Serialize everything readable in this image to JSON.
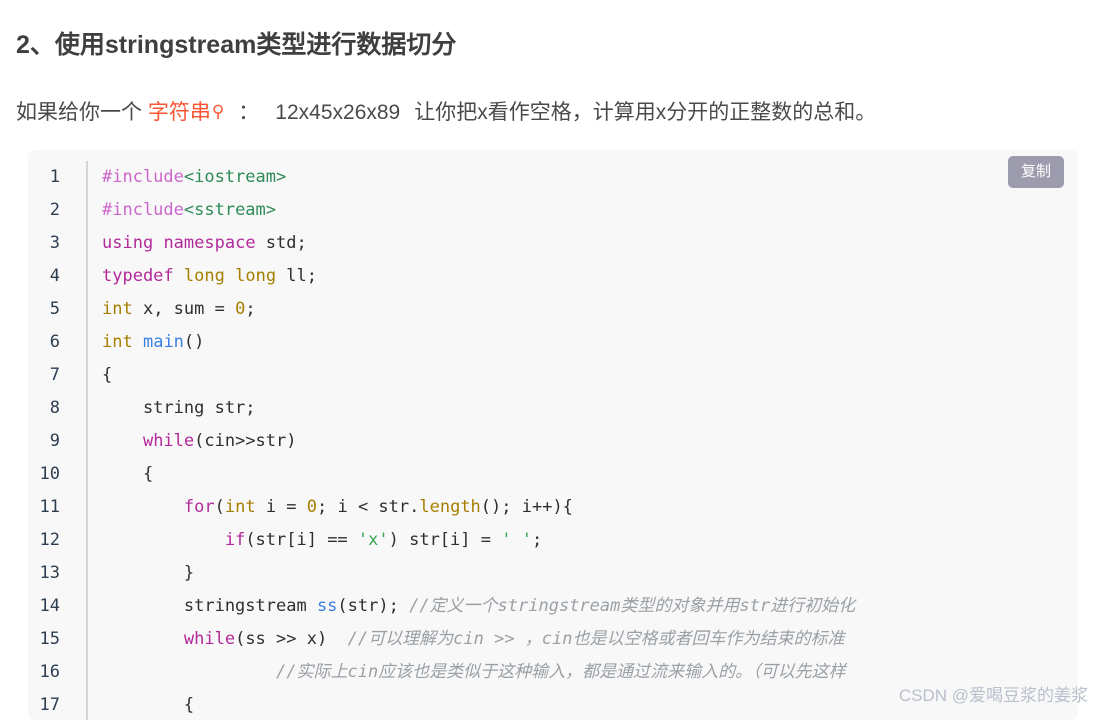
{
  "heading": "2、使用stringstream类型进行数据切分",
  "intro": {
    "prefix": "如果给你一个 ",
    "keyword_link": "字符串",
    "search_icon": "search-icon",
    "colon": "：",
    "sample": "12x45x26x89",
    "suffix": "让你把x看作空格，计算用x分开的正整数的总和。"
  },
  "code_block": {
    "copy_label": "复制",
    "language": "cpp",
    "background": "#f8f8f8",
    "lines": [
      {
        "n": "1",
        "tokens": [
          {
            "t": "#include",
            "c": "t-pre"
          },
          {
            "t": "<iostream>",
            "c": "t-inc"
          }
        ]
      },
      {
        "n": "2",
        "tokens": [
          {
            "t": "#include",
            "c": "t-pre"
          },
          {
            "t": "<sstream>",
            "c": "t-inc"
          }
        ]
      },
      {
        "n": "3",
        "tokens": [
          {
            "t": "using",
            "c": "t-kw"
          },
          {
            "t": " ",
            "c": "t-plain"
          },
          {
            "t": "namespace",
            "c": "t-kw"
          },
          {
            "t": " std;",
            "c": "t-plain"
          }
        ]
      },
      {
        "n": "4",
        "tokens": [
          {
            "t": "typedef",
            "c": "t-kw"
          },
          {
            "t": " ",
            "c": "t-plain"
          },
          {
            "t": "long",
            "c": "t-type"
          },
          {
            "t": " ",
            "c": "t-plain"
          },
          {
            "t": "long",
            "c": "t-type"
          },
          {
            "t": " ll;",
            "c": "t-plain"
          }
        ]
      },
      {
        "n": "5",
        "tokens": [
          {
            "t": "int",
            "c": "t-type"
          },
          {
            "t": " x, sum = ",
            "c": "t-plain"
          },
          {
            "t": "0",
            "c": "t-type"
          },
          {
            "t": ";",
            "c": "t-plain"
          }
        ]
      },
      {
        "n": "6",
        "tokens": [
          {
            "t": "int",
            "c": "t-type"
          },
          {
            "t": " ",
            "c": "t-plain"
          },
          {
            "t": "main",
            "c": "t-fn"
          },
          {
            "t": "()",
            "c": "t-plain"
          }
        ]
      },
      {
        "n": "7",
        "tokens": [
          {
            "t": "{",
            "c": "t-plain"
          }
        ]
      },
      {
        "n": "8",
        "tokens": [
          {
            "t": "    string str;",
            "c": "t-plain"
          }
        ]
      },
      {
        "n": "9",
        "tokens": [
          {
            "t": "    ",
            "c": "t-plain"
          },
          {
            "t": "while",
            "c": "t-kw"
          },
          {
            "t": "(cin>>str)",
            "c": "t-plain"
          }
        ]
      },
      {
        "n": "10",
        "tokens": [
          {
            "t": "    {",
            "c": "t-plain"
          }
        ]
      },
      {
        "n": "11",
        "tokens": [
          {
            "t": "        ",
            "c": "t-plain"
          },
          {
            "t": "for",
            "c": "t-kw"
          },
          {
            "t": "(",
            "c": "t-plain"
          },
          {
            "t": "int",
            "c": "t-type"
          },
          {
            "t": " i = ",
            "c": "t-plain"
          },
          {
            "t": "0",
            "c": "t-type"
          },
          {
            "t": "; i < str.",
            "c": "t-plain"
          },
          {
            "t": "length",
            "c": "t-type"
          },
          {
            "t": "(); i++){",
            "c": "t-plain"
          }
        ]
      },
      {
        "n": "12",
        "tokens": [
          {
            "t": "            ",
            "c": "t-plain"
          },
          {
            "t": "if",
            "c": "t-kw"
          },
          {
            "t": "(str[i] == ",
            "c": "t-plain"
          },
          {
            "t": "'x'",
            "c": "t-str"
          },
          {
            "t": ") str[i] = ",
            "c": "t-plain"
          },
          {
            "t": "' '",
            "c": "t-str"
          },
          {
            "t": ";",
            "c": "t-plain"
          }
        ]
      },
      {
        "n": "13",
        "tokens": [
          {
            "t": "        }",
            "c": "t-plain"
          }
        ]
      },
      {
        "n": "14",
        "tokens": [
          {
            "t": "        stringstream ",
            "c": "t-plain"
          },
          {
            "t": "ss",
            "c": "t-fn"
          },
          {
            "t": "(str); ",
            "c": "t-plain"
          },
          {
            "t": "//定义一个stringstream类型的对象并用str进行初始化",
            "c": "t-cmt"
          }
        ]
      },
      {
        "n": "15",
        "tokens": [
          {
            "t": "        ",
            "c": "t-plain"
          },
          {
            "t": "while",
            "c": "t-kw"
          },
          {
            "t": "(ss >> x)  ",
            "c": "t-plain"
          },
          {
            "t": "//可以理解为cin >> ，cin也是以空格或者回车作为结束的标准",
            "c": "t-cmt"
          }
        ]
      },
      {
        "n": "16",
        "tokens": [
          {
            "t": "                 ",
            "c": "t-plain"
          },
          {
            "t": "//实际上cin应该也是类似于这种输入，都是通过流来输入的。（可以先这样",
            "c": "t-cmt"
          }
        ]
      },
      {
        "n": "17",
        "tokens": [
          {
            "t": "        {",
            "c": "t-plain"
          }
        ]
      }
    ]
  },
  "watermark": "CSDN @爱喝豆浆的姜浆"
}
